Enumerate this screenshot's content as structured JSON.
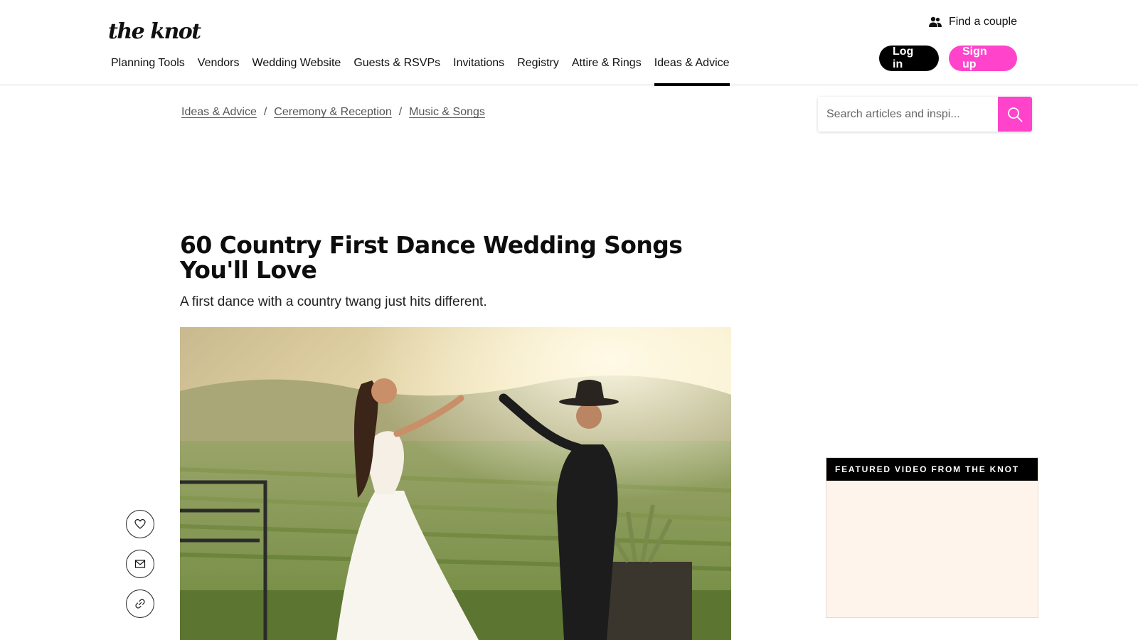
{
  "header": {
    "logo_text": "the knot",
    "find_couple": "Find a couple",
    "login": "Log in",
    "signup": "Sign up",
    "nav": [
      {
        "label": "Planning Tools"
      },
      {
        "label": "Vendors"
      },
      {
        "label": "Wedding Website"
      },
      {
        "label": "Guests & RSVPs"
      },
      {
        "label": "Invitations"
      },
      {
        "label": "Registry"
      },
      {
        "label": "Attire & Rings"
      },
      {
        "label": "Ideas & Advice",
        "active": true
      }
    ]
  },
  "breadcrumb": [
    "Ideas & Advice",
    "Ceremony & Reception",
    "Music & Songs"
  ],
  "breadcrumb_sep": "/",
  "search": {
    "placeholder": "Search articles and inspi..."
  },
  "article": {
    "title": "60 Country First Dance Wedding Songs You'll Love",
    "subtitle": "A first dance with a country twang just hits different."
  },
  "share": {
    "icons": [
      "heart-icon",
      "mail-icon",
      "link-icon"
    ]
  },
  "featured_video": {
    "heading": "FEATURED VIDEO FROM THE KNOT"
  },
  "colors": {
    "brand_pink": "#ff44cb",
    "black": "#000000",
    "video_bg": "#fff4ec"
  }
}
